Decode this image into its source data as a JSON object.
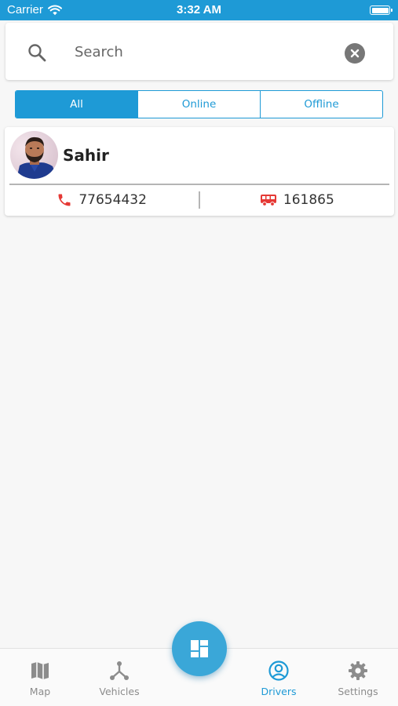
{
  "status_bar": {
    "carrier": "Carrier",
    "time": "3:32 AM"
  },
  "search": {
    "placeholder": "Search",
    "value": ""
  },
  "filters": [
    {
      "label": "All",
      "active": true
    },
    {
      "label": "Online",
      "active": false
    },
    {
      "label": "Offline",
      "active": false
    }
  ],
  "drivers": [
    {
      "name": "Sahir",
      "phone": "77654432",
      "vehicle_id": "161865"
    }
  ],
  "bottom_nav": {
    "items": [
      {
        "label": "Map",
        "icon": "map-icon",
        "active": false
      },
      {
        "label": "Vehicles",
        "icon": "vehicles-icon",
        "active": false
      },
      {
        "label": "Drivers",
        "icon": "drivers-icon",
        "active": true
      },
      {
        "label": "Settings",
        "icon": "gear-icon",
        "active": false
      }
    ],
    "fab_icon": "dashboard-icon"
  },
  "colors": {
    "primary": "#1e9ad6",
    "accent_red": "#e53935",
    "background": "#f7f7f7"
  }
}
